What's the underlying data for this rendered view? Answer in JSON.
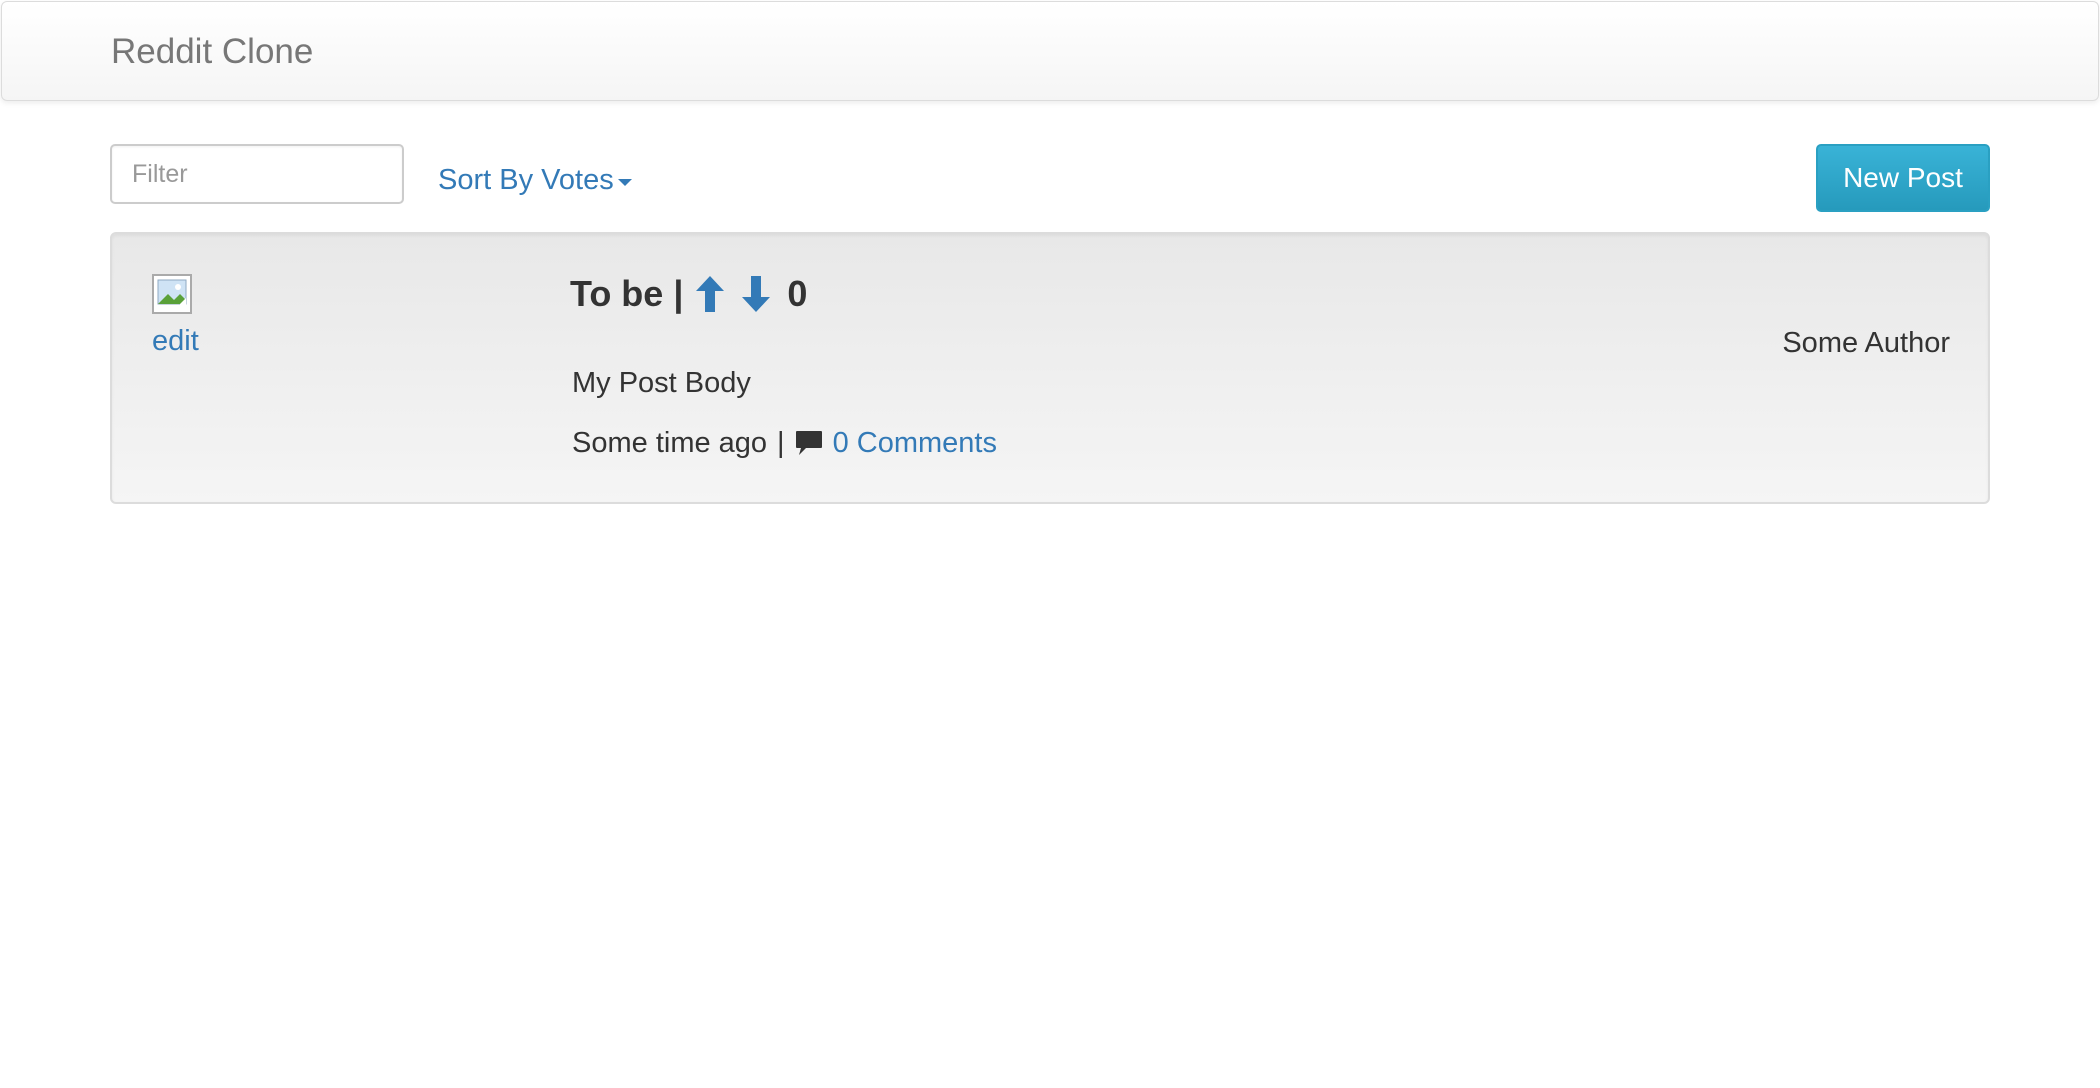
{
  "navbar": {
    "brand": "Reddit Clone"
  },
  "toolbar": {
    "filter_placeholder": "Filter",
    "filter_value": "",
    "sort_label": "Sort By Votes",
    "new_post_label": "New Post"
  },
  "posts": [
    {
      "edit_label": "edit",
      "title": "To be",
      "separator": "|",
      "vote_count": "0",
      "body": "My Post Body",
      "time": "Some time ago",
      "comments_label": "0 Comments",
      "author": "Some Author",
      "icons": {
        "thumbnail": "broken-image-icon",
        "upvote": "arrow-up-icon",
        "downvote": "arrow-down-icon",
        "comment": "comment-icon"
      }
    }
  ],
  "colors": {
    "link": "#337ab7",
    "brand_text": "#777777",
    "button_info": "#31b0d5",
    "card_background": "#f0f0f0",
    "text": "#333333"
  }
}
